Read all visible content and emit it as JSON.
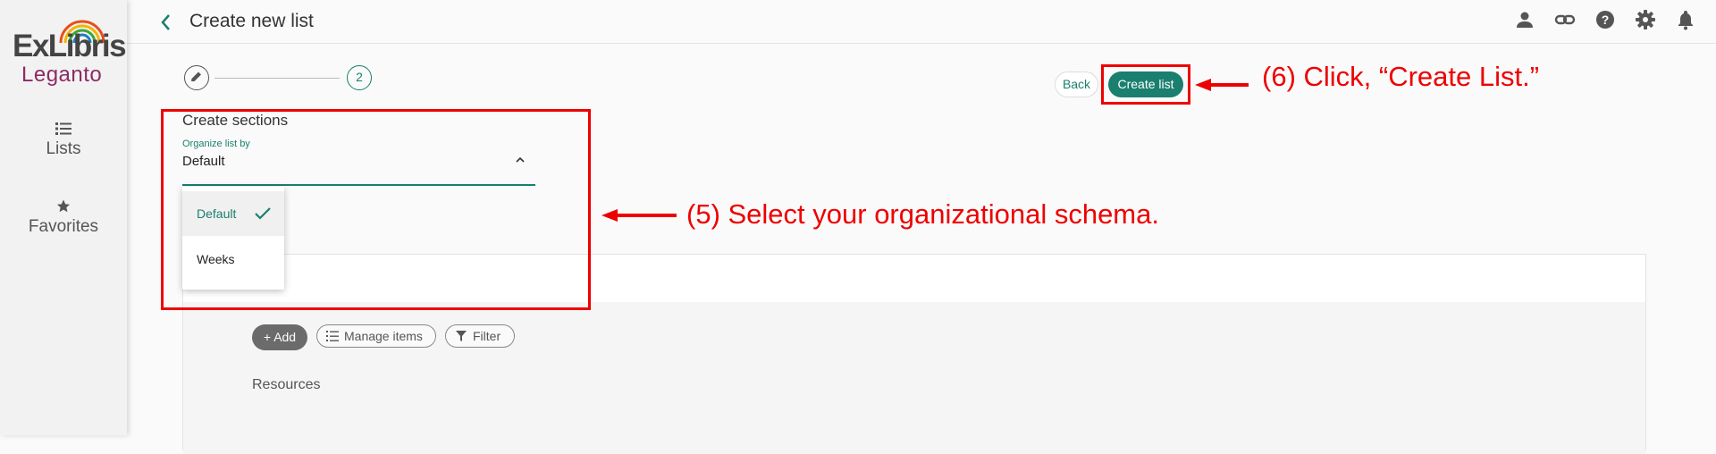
{
  "brand": {
    "name_top": "ExLibris",
    "name_bottom": "Leganto"
  },
  "sidebar": {
    "items": [
      {
        "label": "Lists",
        "icon": "list-icon"
      },
      {
        "label": "Favorites",
        "icon": "star-icon"
      }
    ]
  },
  "header": {
    "title": "Create new list",
    "icons": [
      "user-icon",
      "link-icon",
      "help-icon",
      "gear-icon",
      "bell-icon"
    ]
  },
  "stepper": {
    "step1_icon": "pencil-icon",
    "step2_label": "2"
  },
  "actions": {
    "back_label": "Back",
    "create_label": "Create list"
  },
  "sections": {
    "heading": "Create sections",
    "organize_label": "Organize list by",
    "organize_value": "Default",
    "options": [
      {
        "label": "Default",
        "selected": true
      },
      {
        "label": "Weeks",
        "selected": false
      }
    ]
  },
  "toolbar": {
    "add_label": "Add",
    "manage_label": "Manage items",
    "filter_label": "Filter"
  },
  "content": {
    "resources_label": "Resources"
  },
  "annotations": {
    "step5": "(5) Select your organizational schema.",
    "step6": "(6) Click, “Create List.”"
  },
  "colors": {
    "accent": "#1a7f6e",
    "annotation": "#e00000",
    "brand_purple": "#8d2b64"
  }
}
